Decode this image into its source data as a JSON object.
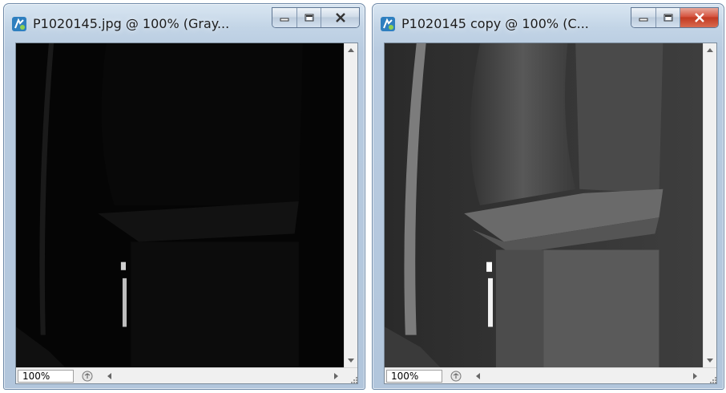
{
  "windows": [
    {
      "title": "P1020145.jpg @ 100% (Gray...",
      "zoom": "100%",
      "active": false,
      "icon": "photoshop-document-icon",
      "image_tone": "dark"
    },
    {
      "title": "P1020145 copy @ 100% (C...",
      "zoom": "100%",
      "active": true,
      "icon": "photoshop-document-icon",
      "image_tone": "brightened"
    }
  ],
  "colors": {
    "close_active": "#c23a22",
    "frame": "#b8cbe0"
  }
}
